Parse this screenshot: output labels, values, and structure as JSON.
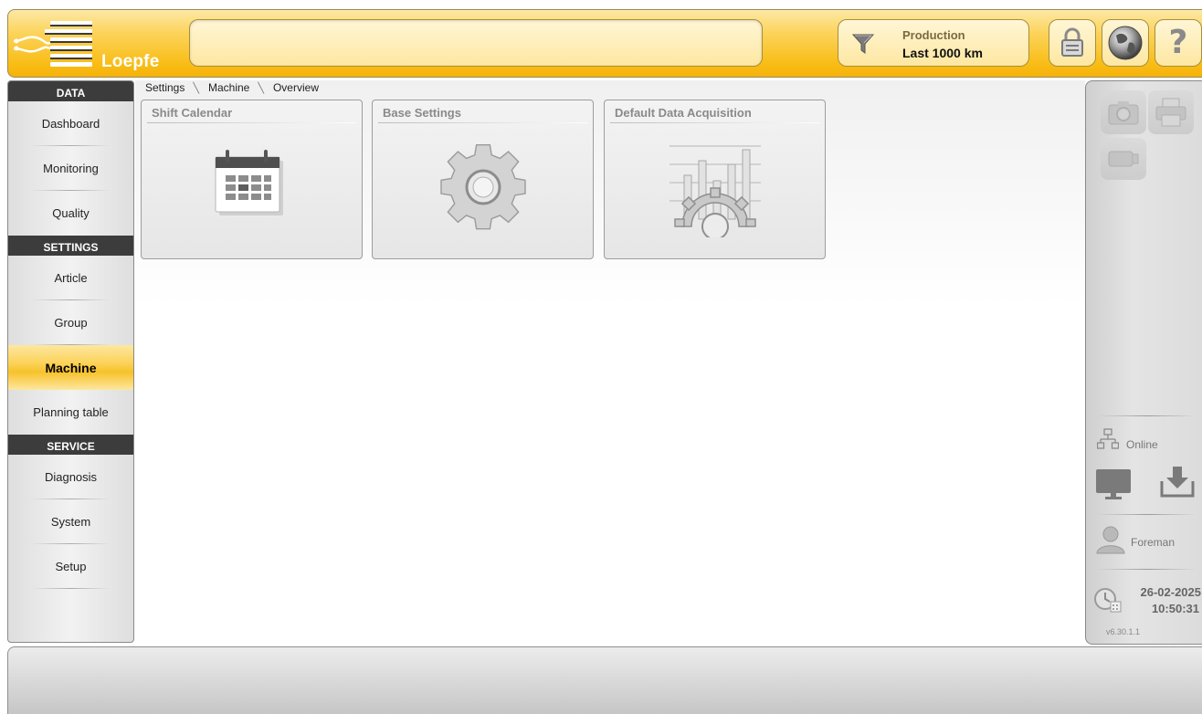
{
  "header": {
    "logo_text": "Loepfe",
    "filter": {
      "line1": "Production",
      "line2": "Last 1000 km",
      "icon": "funnel-icon"
    },
    "buttons": [
      {
        "name": "lock-button",
        "icon": "lock-icon"
      },
      {
        "name": "language-button",
        "icon": "globe-icon"
      },
      {
        "name": "help-button",
        "icon": "question-mark-icon",
        "glyph": "?"
      }
    ]
  },
  "sidebar": {
    "sections": [
      {
        "title": "DATA",
        "items": [
          "Dashboard",
          "Monitoring",
          "Quality"
        ]
      },
      {
        "title": "SETTINGS",
        "items": [
          "Article",
          "Group",
          "Machine",
          "Planning table"
        ]
      },
      {
        "title": "SERVICE",
        "items": [
          "Diagnosis",
          "System",
          "Setup"
        ]
      }
    ],
    "active_item": "Machine"
  },
  "breadcrumb": [
    "Settings",
    "Machine",
    "Overview"
  ],
  "tiles": [
    {
      "title": "Shift Calendar",
      "icon": "calendar-icon"
    },
    {
      "title": "Base Settings",
      "icon": "gear-icon"
    },
    {
      "title": "Default Data Acquisition",
      "icon": "chart-gear-icon"
    }
  ],
  "rightpanel": {
    "connection_status": "Online",
    "user": "Foreman",
    "date": "26-02-2025",
    "time": "10:50:31",
    "version": "v6.30.1.1",
    "icons": [
      "camera-icon",
      "printer-icon",
      "usb-drive-icon",
      "network-icon",
      "monitor-icon",
      "download-icon",
      "user-icon",
      "clock-icon"
    ]
  },
  "colors": {
    "accent": "#f8bd17",
    "nav_dark": "#3c3c3c",
    "active_nav": "#fbd35a"
  }
}
